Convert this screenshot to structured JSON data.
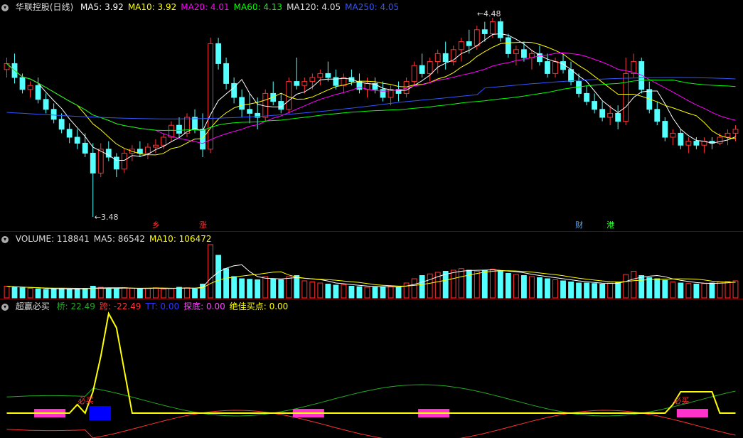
{
  "price_legend": {
    "title": "华联控股(日线)",
    "items": [
      {
        "label": "MA5: 3.92",
        "color": "#ffffff"
      },
      {
        "label": "MA10: 3.92",
        "color": "#ffff00"
      },
      {
        "label": "MA20: 4.01",
        "color": "#ff00ff"
      },
      {
        "label": "MA60: 4.13",
        "color": "#00ff00"
      },
      {
        "label": "MA120: 4.05",
        "color": "#dddddd"
      },
      {
        "label": "MA250: 4.05",
        "color": "#3355ff"
      }
    ]
  },
  "volume_legend": {
    "items": [
      {
        "label": "VOLUME: 118841",
        "color": "#dddddd"
      },
      {
        "label": "MA5: 86542",
        "color": "#dddddd"
      },
      {
        "label": "MA10: 106472",
        "color": "#ffff00"
      }
    ]
  },
  "indicator_legend": {
    "title": "超赢必买",
    "items": [
      {
        "label": "桥: 22.49",
        "color": "#22aa22"
      },
      {
        "label": "跨: -22.49",
        "color": "#ff3333"
      },
      {
        "label": "TT: 0.00",
        "color": "#3333ff"
      },
      {
        "label": "探底: 0.00",
        "color": "#ff44ff"
      },
      {
        "label": "绝佳买点: 0.00",
        "color": "#ffff00"
      }
    ]
  },
  "price_annotations": {
    "high_label": "4.48",
    "low_label": "3.48",
    "event_marks": [
      {
        "text": "乡",
        "color": "#ff3333"
      },
      {
        "text": "涨",
        "color": "#ff3333"
      },
      {
        "text": "财",
        "color": "#55aaff"
      },
      {
        "text": "港",
        "color": "#33ff33"
      }
    ]
  },
  "indicator_annotations": {
    "buy_marks": [
      "必买",
      "必买",
      "必买"
    ]
  },
  "chart_data": {
    "type": "candlestick",
    "price_range": [
      3.48,
      4.48
    ],
    "candles": [
      [
        4.22,
        4.28,
        4.18,
        4.25
      ],
      [
        4.25,
        4.3,
        4.15,
        4.18
      ],
      [
        4.18,
        4.2,
        4.1,
        4.12
      ],
      [
        4.12,
        4.16,
        4.08,
        4.14
      ],
      [
        4.14,
        4.18,
        4.05,
        4.07
      ],
      [
        4.07,
        4.1,
        4.0,
        4.02
      ],
      [
        4.02,
        4.05,
        3.95,
        3.97
      ],
      [
        3.97,
        4.0,
        3.9,
        3.92
      ],
      [
        3.92,
        3.95,
        3.85,
        3.88
      ],
      [
        3.88,
        3.92,
        3.82,
        3.85
      ],
      [
        3.85,
        3.9,
        3.78,
        3.8
      ],
      [
        3.8,
        3.85,
        3.48,
        3.7
      ],
      [
        3.7,
        3.85,
        3.68,
        3.82
      ],
      [
        3.82,
        3.86,
        3.76,
        3.78
      ],
      [
        3.78,
        3.8,
        3.68,
        3.72
      ],
      [
        3.72,
        3.82,
        3.7,
        3.8
      ],
      [
        3.8,
        3.84,
        3.76,
        3.82
      ],
      [
        3.82,
        3.86,
        3.78,
        3.8
      ],
      [
        3.8,
        3.85,
        3.77,
        3.83
      ],
      [
        3.83,
        3.87,
        3.8,
        3.84
      ],
      [
        3.84,
        3.9,
        3.82,
        3.88
      ],
      [
        3.88,
        3.96,
        3.86,
        3.94
      ],
      [
        3.94,
        3.98,
        3.88,
        3.9
      ],
      [
        3.9,
        4.0,
        3.88,
        3.98
      ],
      [
        3.98,
        4.02,
        3.9,
        3.92
      ],
      [
        3.92,
        4.0,
        3.78,
        3.82
      ],
      [
        3.82,
        4.38,
        3.8,
        4.35
      ],
      [
        4.35,
        4.38,
        4.22,
        4.25
      ],
      [
        4.25,
        4.28,
        4.12,
        4.15
      ],
      [
        4.15,
        4.18,
        4.05,
        4.08
      ],
      [
        4.08,
        4.12,
        3.98,
        4.02
      ],
      [
        4.02,
        4.1,
        3.95,
        4.0
      ],
      [
        4.0,
        4.08,
        3.92,
        3.98
      ],
      [
        3.98,
        4.12,
        3.96,
        4.1
      ],
      [
        4.1,
        4.16,
        4.04,
        4.06
      ],
      [
        4.06,
        4.1,
        4.0,
        4.02
      ],
      [
        4.02,
        4.18,
        4.0,
        4.16
      ],
      [
        4.16,
        4.28,
        4.12,
        4.14
      ],
      [
        4.14,
        4.18,
        4.1,
        4.16
      ],
      [
        4.16,
        4.2,
        4.12,
        4.18
      ],
      [
        4.18,
        4.22,
        4.14,
        4.2
      ],
      [
        4.2,
        4.26,
        4.16,
        4.18
      ],
      [
        4.18,
        4.22,
        4.12,
        4.14
      ],
      [
        4.14,
        4.2,
        4.1,
        4.18
      ],
      [
        4.18,
        4.22,
        4.14,
        4.16
      ],
      [
        4.16,
        4.2,
        4.1,
        4.12
      ],
      [
        4.12,
        4.18,
        4.08,
        4.15
      ],
      [
        4.15,
        4.18,
        4.1,
        4.12
      ],
      [
        4.12,
        4.16,
        4.06,
        4.08
      ],
      [
        4.08,
        4.14,
        4.04,
        4.12
      ],
      [
        4.12,
        4.16,
        4.06,
        4.1
      ],
      [
        4.1,
        4.18,
        4.08,
        4.16
      ],
      [
        4.16,
        4.26,
        4.14,
        4.24
      ],
      [
        4.24,
        4.3,
        4.18,
        4.2
      ],
      [
        4.2,
        4.28,
        4.16,
        4.26
      ],
      [
        4.26,
        4.32,
        4.2,
        4.3
      ],
      [
        4.3,
        4.36,
        4.22,
        4.26
      ],
      [
        4.26,
        4.34,
        4.24,
        4.32
      ],
      [
        4.32,
        4.38,
        4.26,
        4.36
      ],
      [
        4.36,
        4.42,
        4.3,
        4.34
      ],
      [
        4.34,
        4.44,
        4.32,
        4.42
      ],
      [
        4.42,
        4.46,
        4.36,
        4.4
      ],
      [
        4.4,
        4.48,
        4.38,
        4.46
      ],
      [
        4.46,
        4.48,
        4.36,
        4.38
      ],
      [
        4.38,
        4.4,
        4.28,
        4.3
      ],
      [
        4.3,
        4.34,
        4.24,
        4.32
      ],
      [
        4.32,
        4.36,
        4.26,
        4.28
      ],
      [
        4.28,
        4.32,
        4.22,
        4.3
      ],
      [
        4.3,
        4.34,
        4.24,
        4.26
      ],
      [
        4.26,
        4.3,
        4.18,
        4.2
      ],
      [
        4.2,
        4.28,
        4.18,
        4.26
      ],
      [
        4.26,
        4.3,
        4.2,
        4.22
      ],
      [
        4.22,
        4.26,
        4.14,
        4.16
      ],
      [
        4.16,
        4.2,
        4.08,
        4.1
      ],
      [
        4.1,
        4.14,
        4.04,
        4.06
      ],
      [
        4.06,
        4.1,
        4.0,
        4.02
      ],
      [
        4.02,
        4.06,
        3.96,
        3.98
      ],
      [
        3.98,
        4.04,
        3.94,
        4.0
      ],
      [
        4.0,
        4.04,
        3.92,
        3.96
      ],
      [
        3.96,
        4.28,
        3.94,
        4.2
      ],
      [
        4.2,
        4.3,
        4.18,
        4.26
      ],
      [
        4.26,
        4.28,
        4.1,
        4.12
      ],
      [
        4.12,
        4.16,
        4.0,
        4.02
      ],
      [
        4.02,
        4.06,
        3.94,
        3.96
      ],
      [
        3.96,
        3.98,
        3.86,
        3.88
      ],
      [
        3.88,
        3.92,
        3.84,
        3.9
      ],
      [
        3.9,
        3.92,
        3.82,
        3.84
      ],
      [
        3.84,
        3.88,
        3.8,
        3.86
      ],
      [
        3.86,
        3.88,
        3.82,
        3.84
      ],
      [
        3.84,
        3.88,
        3.8,
        3.86
      ],
      [
        3.86,
        3.88,
        3.82,
        3.85
      ],
      [
        3.85,
        3.9,
        3.84,
        3.88
      ],
      [
        3.88,
        3.92,
        3.84,
        3.9
      ],
      [
        3.9,
        3.94,
        3.86,
        3.92
      ]
    ],
    "volumes": [
      0.22,
      0.2,
      0.19,
      0.18,
      0.17,
      0.16,
      0.17,
      0.18,
      0.16,
      0.17,
      0.18,
      0.22,
      0.2,
      0.18,
      0.17,
      0.19,
      0.18,
      0.17,
      0.18,
      0.19,
      0.17,
      0.18,
      0.2,
      0.19,
      0.17,
      0.26,
      1.0,
      0.8,
      0.55,
      0.4,
      0.36,
      0.35,
      0.34,
      0.4,
      0.36,
      0.34,
      0.4,
      0.42,
      0.32,
      0.3,
      0.28,
      0.26,
      0.24,
      0.25,
      0.22,
      0.21,
      0.2,
      0.2,
      0.21,
      0.22,
      0.2,
      0.28,
      0.36,
      0.42,
      0.45,
      0.48,
      0.5,
      0.52,
      0.55,
      0.52,
      0.5,
      0.52,
      0.54,
      0.5,
      0.46,
      0.44,
      0.42,
      0.4,
      0.38,
      0.36,
      0.34,
      0.32,
      0.3,
      0.28,
      0.28,
      0.27,
      0.26,
      0.28,
      0.3,
      0.44,
      0.5,
      0.42,
      0.38,
      0.36,
      0.33,
      0.3,
      0.28,
      0.27,
      0.26,
      0.27,
      0.28,
      0.3,
      0.31,
      0.32
    ]
  }
}
